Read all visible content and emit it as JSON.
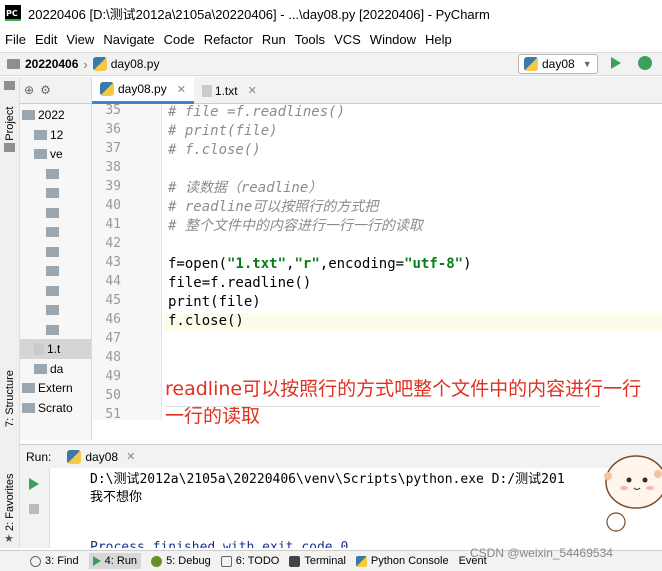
{
  "window": {
    "title": "20220406 [D:\\测试2012a\\2105a\\20220406] - ...\\day08.py [20220406] - PyCharm",
    "logo": "PC"
  },
  "menu": [
    "File",
    "Edit",
    "View",
    "Navigate",
    "Code",
    "Refactor",
    "Run",
    "Tools",
    "VCS",
    "Window",
    "Help"
  ],
  "navbar": {
    "project": "20220406",
    "file": "day08.py",
    "run_config": "day08"
  },
  "left_tools": {
    "project": "1: Project",
    "structure": "7: Structure",
    "favorites": "2: Favorites"
  },
  "tree": {
    "rows": [
      {
        "label": "2022",
        "indent": 0
      },
      {
        "label": "12",
        "indent": 1
      },
      {
        "label": "ve",
        "indent": 1
      },
      {
        "label": "",
        "indent": 2
      },
      {
        "label": "",
        "indent": 2
      },
      {
        "label": "",
        "indent": 2
      },
      {
        "label": "",
        "indent": 2
      },
      {
        "label": "",
        "indent": 2
      },
      {
        "label": "",
        "indent": 2
      },
      {
        "label": "",
        "indent": 2
      },
      {
        "label": "",
        "indent": 2
      },
      {
        "label": "",
        "indent": 2
      },
      {
        "label": "1.t",
        "indent": 1
      },
      {
        "label": "da",
        "indent": 1
      },
      {
        "label": "Extern",
        "indent": 0
      },
      {
        "label": "Scrato",
        "indent": 0
      }
    ]
  },
  "tabs": [
    {
      "label": "day08.py",
      "active": true
    },
    {
      "label": "1.txt",
      "active": false
    }
  ],
  "editor": {
    "line_numbers": [
      "35",
      "36",
      "37",
      "38",
      "39",
      "40",
      "41",
      "42",
      "43",
      "44",
      "45",
      "46",
      "47",
      "48",
      "49",
      "50",
      "51"
    ],
    "lines": [
      "# file =f.readlines()",
      "# print(file)",
      "# f.close()",
      "",
      "# 读数据（readline）",
      "# readline可以按照行的方式把",
      "# 整个文件中的内容进行一行一行的读取",
      "",
      "f=open(\"1.txt\",\"r\",encoding=\"utf-8\")",
      "file=f.readline()",
      "print(file)",
      "f.close()"
    ]
  },
  "overlay_note": "readline可以按照行的方式吧整个文件中的内容进行一行一行的读取",
  "run_panel": {
    "label": "Run:",
    "tab": "day08",
    "output": [
      "D:\\测试2012a\\2105a\\20220406\\venv\\Scripts\\python.exe D:/测试201",
      "我不想你",
      "",
      "",
      "Process finished with exit code 0"
    ]
  },
  "bottom_tools": [
    "3: Find",
    "4: Run",
    "5: Debug",
    "6: TODO",
    "Terminal",
    "Python Console",
    "Event"
  ],
  "watermark": "CSDN @weixin_54469534",
  "colors": {
    "comment": "#8c8c8c",
    "string": "#067d17",
    "overlay": "#e03020",
    "run_green": "#3aa05a",
    "tab_accent": "#4083c9"
  }
}
